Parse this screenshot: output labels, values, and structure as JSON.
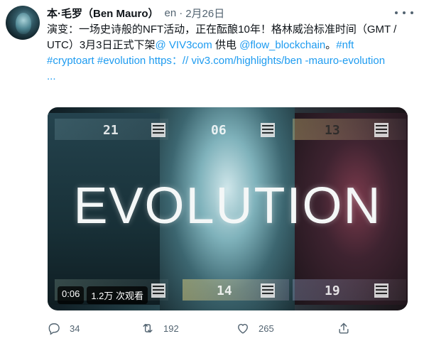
{
  "author": {
    "display_name": "本·毛罗（Ben Mauro）",
    "meta": "en",
    "separator": "·",
    "date": "2月26日"
  },
  "tweet": {
    "line1": "演变：一场史诗般的NFT活动，正在酝酿10年！格林威治标准时间（GMT /",
    "line2_prefix": "UTC）3月3日正式下架",
    "line2_link1": "@ VIV3com",
    "line2_mid": " 供电 ",
    "line2_link2": "@flow_blockchain",
    "line2_sep": "。",
    "line2_link3": "#nft",
    "line3": "#cryptoart #evolution https：// viv3.com/highlights/ben -mauro-evolution",
    "line4": "..."
  },
  "media": {
    "title": "EVOLUTION",
    "card_numbers": [
      "21",
      "06",
      "13",
      "14",
      "19"
    ],
    "duration": "0:06",
    "views": "1.2万 次观看"
  },
  "actions": {
    "reply_count": "34",
    "retweet_count": "192",
    "like_count": "265"
  },
  "icons": {
    "reply": "reply-icon",
    "retweet": "retweet-icon",
    "like": "heart-icon",
    "share": "share-icon",
    "more": "more-icon"
  },
  "colors": {
    "link": "#1d9bf0",
    "text": "#0f1419",
    "muted": "#536471"
  }
}
